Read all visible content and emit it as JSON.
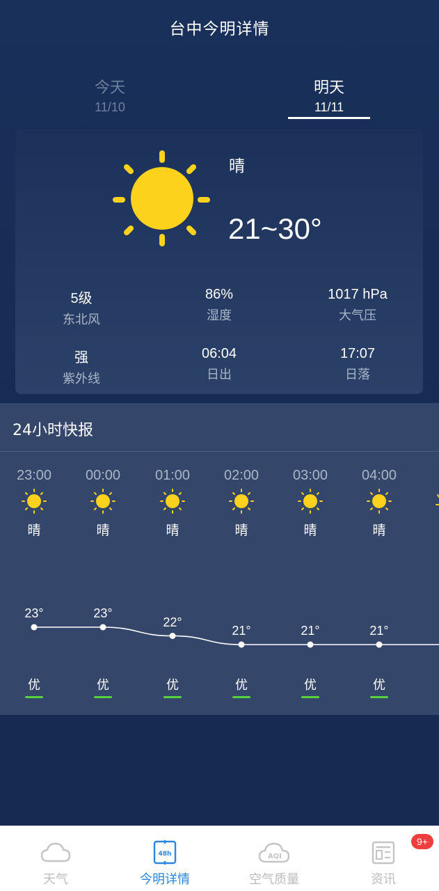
{
  "header": {
    "title": "台中今明详情"
  },
  "tabs": [
    {
      "label": "今天",
      "date": "11/10",
      "active": false
    },
    {
      "label": "明天",
      "date": "11/11",
      "active": true
    }
  ],
  "summary": {
    "icon": "sun-icon",
    "condition": "晴",
    "temp_range": "21~30°",
    "stats": [
      {
        "value": "5级",
        "label": "东北风"
      },
      {
        "value": "86%",
        "label": "湿度"
      },
      {
        "value": "1017 hPa",
        "label": "大气压"
      },
      {
        "value": "强",
        "label": "紫外线"
      },
      {
        "value": "06:04",
        "label": "日出"
      },
      {
        "value": "17:07",
        "label": "日落"
      }
    ]
  },
  "hourly": {
    "title": "24小时快报",
    "hours": [
      {
        "time": "23:00",
        "condition": "晴",
        "temp": 23,
        "temp_label": "23°",
        "aqi": "优"
      },
      {
        "time": "00:00",
        "condition": "晴",
        "temp": 23,
        "temp_label": "23°",
        "aqi": "优"
      },
      {
        "time": "01:00",
        "condition": "晴",
        "temp": 22,
        "temp_label": "22°",
        "aqi": "优"
      },
      {
        "time": "02:00",
        "condition": "晴",
        "temp": 21,
        "temp_label": "21°",
        "aqi": "优"
      },
      {
        "time": "03:00",
        "condition": "晴",
        "temp": 21,
        "temp_label": "21°",
        "aqi": "优"
      },
      {
        "time": "04:00",
        "condition": "晴",
        "temp": 21,
        "temp_label": "21°",
        "aqi": "优"
      }
    ]
  },
  "nav": {
    "items": [
      {
        "label": "天气",
        "icon": "cloud-icon",
        "active": false
      },
      {
        "label": "今明详情",
        "icon": "48h-icon",
        "active": true
      },
      {
        "label": "空气质量",
        "icon": "aqi-cloud-icon",
        "active": false
      },
      {
        "label": "资讯",
        "icon": "news-icon",
        "active": false
      }
    ],
    "badge": "9+"
  },
  "colors": {
    "background": "#17294f",
    "accent": "#2a86e0",
    "sun": "#fcd21d",
    "aqi_good": "#58d23e",
    "badge": "#ef3e3e"
  }
}
